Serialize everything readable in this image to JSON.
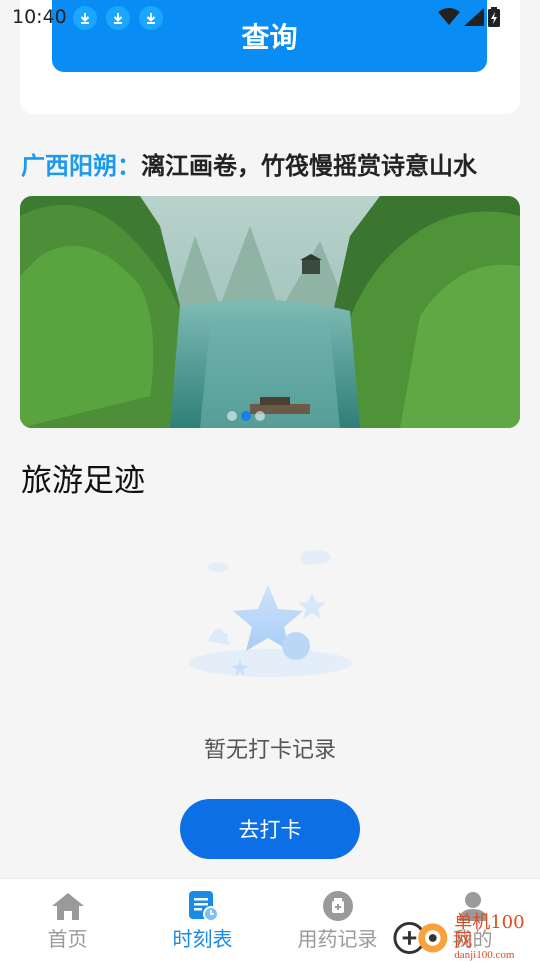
{
  "status_bar": {
    "time": "10:40",
    "download_icons": [
      "download-icon",
      "download-icon",
      "download-icon"
    ]
  },
  "query": {
    "button_label": "查询"
  },
  "headline": {
    "place": "广西阳朔：",
    "description": "漓江画卷，竹筏慢摇赏诗意山水"
  },
  "banner": {
    "image": "li-river-landscape",
    "active_index": 1,
    "dot_count": 3
  },
  "footprints": {
    "title": "旅游足迹",
    "empty_text": "暂无打卡记录",
    "checkin_label": "去打卡"
  },
  "tab_bar": {
    "tabs": [
      {
        "label": "首页",
        "icon": "home-icon",
        "active": false
      },
      {
        "label": "时刻表",
        "icon": "schedule-icon",
        "active": true
      },
      {
        "label": "用药记录",
        "icon": "medicine-icon",
        "active": false
      },
      {
        "label": "我的",
        "icon": "profile-icon",
        "active": false
      }
    ]
  },
  "watermark": {
    "big": "单机100网",
    "small": "danji100.com"
  },
  "colors": {
    "primary": "#0a8cf5",
    "accent_text": "#1b9af0",
    "button": "#0d6fe6",
    "watermark": "#e04a1f"
  }
}
